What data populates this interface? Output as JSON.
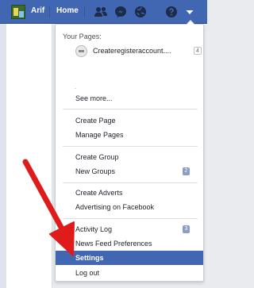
{
  "topbar": {
    "user_name": "Arif",
    "home_label": "Home",
    "icons": [
      "friend-requests-icon",
      "messenger-icon",
      "notifications-globe-icon",
      "help-icon",
      "account-dropdown-icon"
    ],
    "color": "#4267b2"
  },
  "menu": {
    "your_pages_heading": "Your Pages:",
    "page": {
      "name": "Createregisteraccount....",
      "count": "4"
    },
    "placeholder_dot": ".",
    "see_more": "See more...",
    "items": [
      {
        "label": "Create Page"
      },
      {
        "label": "Manage Pages"
      },
      {
        "label": "Create Group"
      },
      {
        "label": "New Groups",
        "badge": "2"
      },
      {
        "label": "Create Adverts"
      },
      {
        "label": "Advertising on Facebook"
      },
      {
        "label": "Activity Log",
        "badge": "3"
      },
      {
        "label": "News Feed Preferences"
      },
      {
        "label": "Settings"
      },
      {
        "label": "Log out"
      }
    ],
    "active_item": "Settings"
  },
  "annotation": {
    "arrow_color": "#e01b1b"
  }
}
